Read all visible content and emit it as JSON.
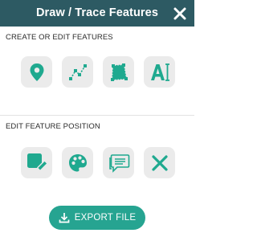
{
  "header": {
    "title": "Draw / Trace Features",
    "background": "#2d5a63"
  },
  "sections": {
    "create": {
      "label": "CREATE OR EDIT FEATURES",
      "tools": [
        {
          "name": "marker-point",
          "icon": "map-pin-icon"
        },
        {
          "name": "line",
          "icon": "polyline-icon"
        },
        {
          "name": "polygon",
          "icon": "polygon-icon"
        },
        {
          "name": "text",
          "icon": "text-cursor-icon"
        }
      ]
    },
    "edit": {
      "label": "EDIT FEATURE POSITION",
      "tools": [
        {
          "name": "edit-shape",
          "icon": "square-pencil-icon"
        },
        {
          "name": "style",
          "icon": "palette-icon"
        },
        {
          "name": "label",
          "icon": "comment-icon"
        },
        {
          "name": "delete",
          "icon": "x-icon"
        }
      ]
    }
  },
  "export": {
    "label": "EXPORT FILE",
    "color": "#26a491"
  },
  "accent_color": "#1fa98f"
}
